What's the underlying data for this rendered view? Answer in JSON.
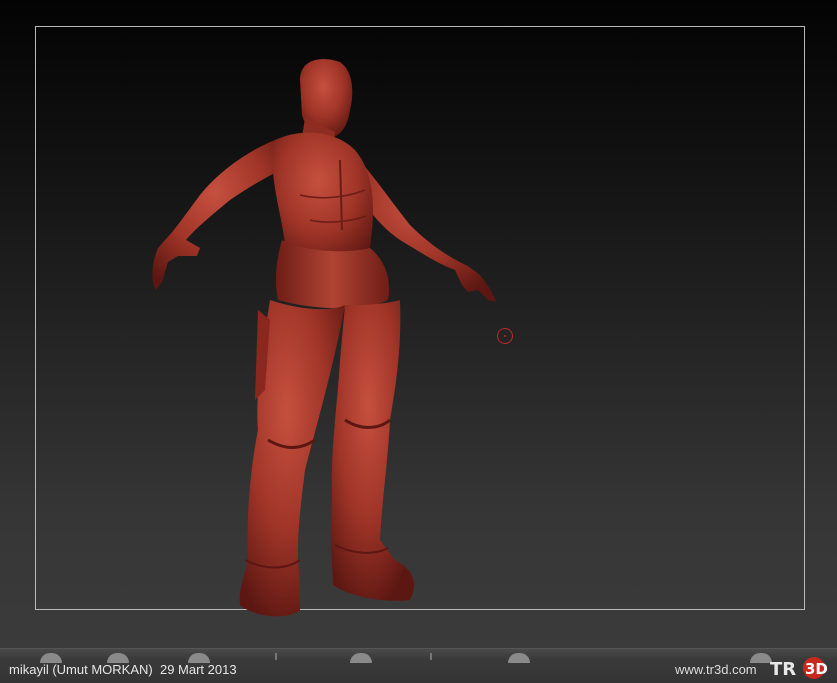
{
  "viewport": {
    "canvas_name": "zbrush-document-canvas"
  },
  "footer": {
    "author": "mikayil (Umut MORKAN)",
    "date": "29 Mart 2013",
    "site": "www.tr3d.com",
    "logo_text": "TR3D"
  },
  "colors": {
    "clay": "#a8382c",
    "clay_dark": "#5c1712",
    "cursor": "#c0282a",
    "frame": "#b8b8b8"
  }
}
